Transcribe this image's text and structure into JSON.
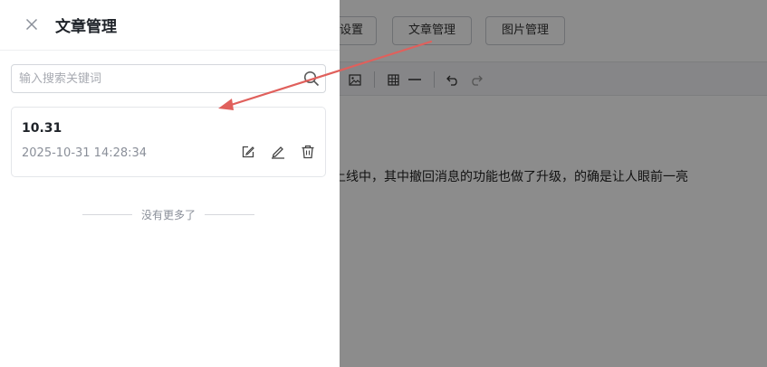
{
  "background": {
    "buttons": {
      "settings": "设置",
      "articles": "文章管理",
      "images": "图片管理"
    },
    "body_text": "悄然上线中，其中撤回消息的功能也做了升级，的确是让人眼前一亮"
  },
  "drawer": {
    "title": "文章管理",
    "search": {
      "placeholder": "输入搜索关键词",
      "value": ""
    },
    "articles": [
      {
        "title": "10.31",
        "date": "2025-10-31 14:28:34"
      }
    ],
    "no_more_text": "没有更多了"
  },
  "colors": {
    "annotation_arrow": "#e0605c",
    "overlay": "#000000",
    "title_text": "#1f2329",
    "muted_text": "#8a8f99"
  },
  "icons": [
    "close-icon",
    "search-icon",
    "edit-icon",
    "pencil-icon",
    "trash-icon",
    "image-icon",
    "table-icon",
    "horizontal-rule-icon",
    "undo-icon",
    "redo-icon"
  ]
}
